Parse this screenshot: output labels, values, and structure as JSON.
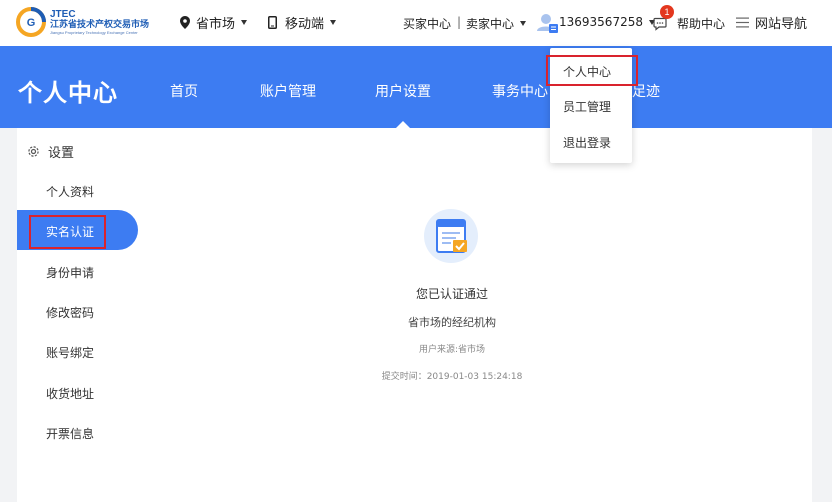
{
  "logo": {
    "en": "JTEC",
    "cn": "江苏省技术产权交易市场",
    "sub": "Jiangsu Proprietary Technology Exchange Center"
  },
  "topbar": {
    "market": "省市场",
    "mobile": "移动端",
    "buyer": "买家中心",
    "separator": "|",
    "seller": "卖家中心",
    "phone": "13693567258",
    "badge_count": "1",
    "help": "帮助中心",
    "site_nav": "网站导航"
  },
  "nav": {
    "title": "个人中心",
    "items": [
      "首页",
      "账户管理",
      "用户设置",
      "事务中心",
      "足迹"
    ]
  },
  "dropdown": {
    "items": [
      "个人中心",
      "员工管理",
      "退出登录"
    ]
  },
  "sidebar": {
    "heading": "设置",
    "items": [
      "个人资料",
      "实名认证",
      "身份申请",
      "修改密码",
      "账号绑定",
      "收货地址",
      "开票信息"
    ]
  },
  "main": {
    "status": "您已认证通过",
    "org": "省市场的经纪机构",
    "source": "用户来源:省市场",
    "submit_time": "提交时间：2019-01-03 15:24:18"
  },
  "colors": {
    "primary": "#3d7cf2",
    "highlight": "#d9232d",
    "badge": "#e3371e",
    "check": "#f5a623"
  }
}
